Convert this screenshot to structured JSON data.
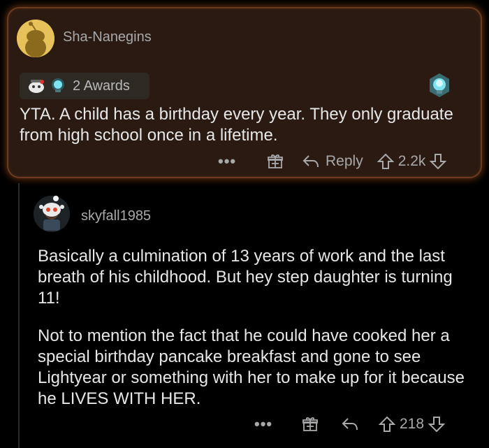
{
  "top_comment": {
    "username": "Sha-Nanegins",
    "awards_label": "2 Awards",
    "body": "YTA. A child has a birthday every year. They only graduate from high school once in a lifetime.",
    "actions": {
      "more": "•••",
      "reply_label": "Reply",
      "score": "2.2k"
    },
    "icons": [
      "snoo-avatar",
      "wholesome-award-icon",
      "lightbulb-award-icon",
      "gift-icon",
      "reply-icon",
      "upvote-icon",
      "downvote-icon"
    ],
    "colors": {
      "glow": "#6b3a1f",
      "card": "#2a1a12"
    }
  },
  "reply_comment": {
    "username": "skyfall1985",
    "paragraphs": [
      "Basically a culmination of 13 years of work and the last breath of his childhood. But hey step daughter is turning 11!",
      "Not to mention the fact that he could have cooked her a special birthday pancake breakfast and gone to see Lightyear or something with her to make up for it because he LIVES WITH HER."
    ],
    "actions": {
      "more": "•••",
      "score": "218"
    }
  }
}
